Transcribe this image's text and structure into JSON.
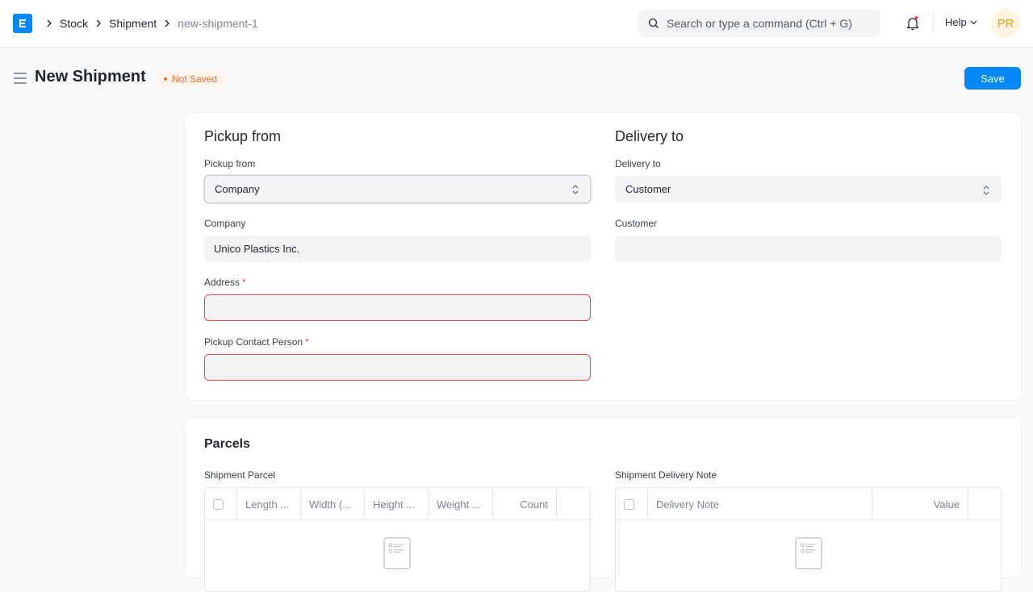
{
  "navbar": {
    "logo_letter": "E",
    "breadcrumbs": [
      "Stock",
      "Shipment",
      "new-shipment-1"
    ],
    "search_placeholder": "Search or type a command (Ctrl + G)",
    "help_label": "Help",
    "avatar_initials": "PR"
  },
  "page": {
    "title": "New Shipment",
    "status_badge": "Not Saved",
    "save_label": "Save"
  },
  "pickup": {
    "section_title": "Pickup from",
    "pickup_from_label": "Pickup from",
    "pickup_from_value": "Company",
    "company_label": "Company",
    "company_value": "Unico Plastics Inc.",
    "address_label": "Address",
    "address_value": "",
    "contact_label": "Pickup Contact Person",
    "contact_value": "",
    "required_mark": "*"
  },
  "delivery": {
    "section_title": "Delivery to",
    "delivery_to_label": "Delivery to",
    "delivery_to_value": "Customer",
    "customer_label": "Customer",
    "customer_value": ""
  },
  "parcels": {
    "section_title": "Parcels",
    "parcel_table_label": "Shipment Parcel",
    "parcel_columns": [
      "Length ...",
      "Width (...",
      "Height ...",
      "Weight ...",
      "Count"
    ],
    "delivery_note_table_label": "Shipment Delivery Note",
    "delivery_note_columns": [
      "Delivery Note",
      "Value"
    ]
  },
  "colors": {
    "primary": "#0289f7",
    "warning": "#f36c2b",
    "error": "#e24c4c",
    "avatar": "#e8a317"
  }
}
